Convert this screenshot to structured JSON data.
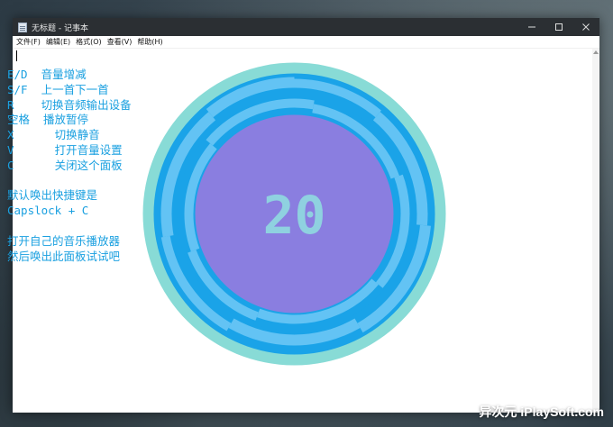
{
  "window": {
    "title": "无标题 - 记事本",
    "minimize_icon": "minimize-icon",
    "maximize_icon": "maximize-icon",
    "close_icon": "close-icon"
  },
  "menu": [
    "文件(F)",
    "编辑(E)",
    "格式(O)",
    "查看(V)",
    "帮助(H)"
  ],
  "help_lines": [
    "E/D  音量增减",
    "S/F  上一首下一首",
    "R    切换音频输出设备",
    "空格  播放暂停",
    "X      切换静音",
    "V      打开音量设置",
    "C      关闭这个面板",
    "",
    "默认唤出快捷键是",
    "Capslock + C",
    "",
    "打开自己的音乐播放器",
    "然后唤出此面板试试吧"
  ],
  "volume_widget": {
    "value": "20",
    "colors": {
      "outer_ring": "#88dbd6",
      "blue_ring": "#1aa3e8",
      "light_ring": "#63c3f4",
      "inner_disc": "#8a7ee0",
      "number": "#8fd1e0"
    }
  },
  "watermark": "异次元 iPlaySoft.com"
}
